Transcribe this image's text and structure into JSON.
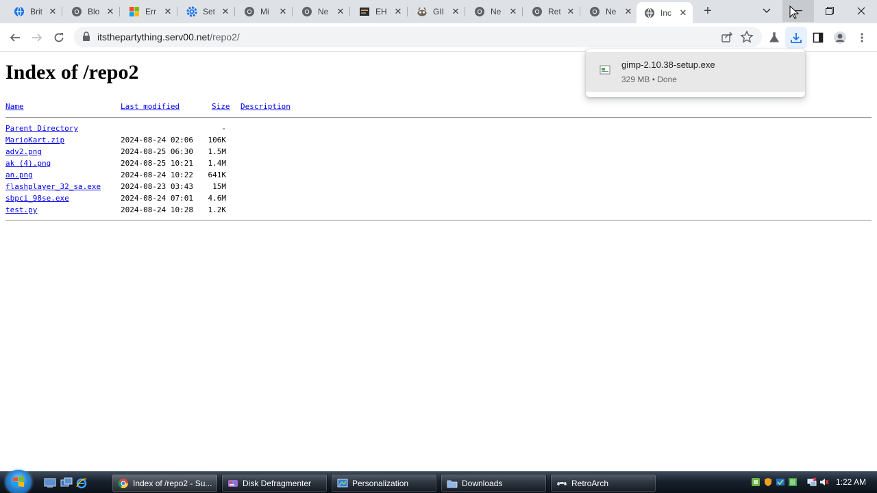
{
  "browser": {
    "tabs": [
      {
        "title": "Brit",
        "favicon": "globe-icon",
        "close": "✕"
      },
      {
        "title": "Blo",
        "favicon": "chrome-icon",
        "close": "✕"
      },
      {
        "title": "Err",
        "favicon": "microsoft-icon",
        "close": "✕"
      },
      {
        "title": "Set",
        "favicon": "gear-icon",
        "close": "✕"
      },
      {
        "title": "Mi",
        "favicon": "chrome-icon",
        "close": "✕"
      },
      {
        "title": "Ne",
        "favicon": "chrome-icon",
        "close": "✕"
      },
      {
        "title": "EH",
        "favicon": "dark-site-icon",
        "close": "✕"
      },
      {
        "title": "GII",
        "favicon": "gimp-icon",
        "close": "✕"
      },
      {
        "title": "Ne",
        "favicon": "chrome-icon",
        "close": "✕"
      },
      {
        "title": "Ret",
        "favicon": "chrome-icon",
        "close": "✕"
      },
      {
        "title": "Ne",
        "favicon": "chrome-icon",
        "close": "✕"
      },
      {
        "title": "Inc",
        "favicon": "globe-icon",
        "close": "✕",
        "active": true
      }
    ],
    "new_tab_label": "+",
    "address": {
      "host": "itsthepartything.serv00.net",
      "path": "/repo2/"
    }
  },
  "download": {
    "filename": "gimp-2.10.38-setup.exe",
    "status": "329 MB • Done"
  },
  "page": {
    "heading": "Index of /repo2",
    "columns": {
      "name": "Name",
      "modified": "Last modified",
      "size": "Size",
      "description": "Description"
    },
    "rows": [
      {
        "name": "Parent Directory",
        "modified": "",
        "size": "-"
      },
      {
        "name": "MarioKart.zip",
        "modified": "2024-08-24 02:06",
        "size": "106K"
      },
      {
        "name": "adv2.png",
        "modified": "2024-08-25 06:30",
        "size": "1.5M"
      },
      {
        "name": "ak (4).png",
        "modified": "2024-08-25 10:21",
        "size": "1.4M"
      },
      {
        "name": "an.png",
        "modified": "2024-08-24 10:22",
        "size": "641K"
      },
      {
        "name": "flashplayer_32_sa.exe",
        "modified": "2024-08-23 03:43",
        "size": "15M"
      },
      {
        "name": "sbpci_98se.exe",
        "modified": "2024-08-24 07:01",
        "size": "4.6M"
      },
      {
        "name": "test.py",
        "modified": "2024-08-24 10:28",
        "size": "1.2K"
      }
    ]
  },
  "taskbar": {
    "tasks": [
      {
        "label": "Index of /repo2 - Su...",
        "icon": "chrome-icon",
        "active": true
      },
      {
        "label": "Disk Defragmenter",
        "icon": "defrag-icon"
      },
      {
        "label": "Personalization",
        "icon": "personalization-icon"
      },
      {
        "label": "Downloads",
        "icon": "folder-icon"
      },
      {
        "label": "RetroArch",
        "icon": "retroarch-icon"
      }
    ],
    "clock": "1:22 AM"
  },
  "colors": {
    "link": "#0000ee",
    "tabstrip": "#dee1e6",
    "download_accent": "#1a73e8"
  }
}
